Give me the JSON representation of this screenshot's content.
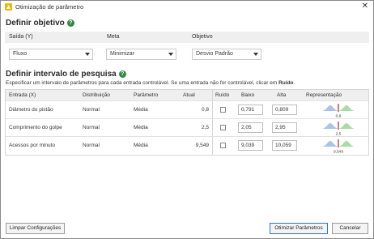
{
  "window": {
    "title": "Otimização de parâmetro",
    "close_glyph": "✕"
  },
  "objective": {
    "heading": "Definir objetivo",
    "columns": {
      "output": "Saída (Y)",
      "goal": "Meta",
      "target": "Objetivo"
    },
    "output_value": "Fluxo",
    "goal_value": "Minimizar",
    "target_value": "Desvio Padrão"
  },
  "search": {
    "heading": "Definir intervalo de pesquisa",
    "hint_prefix": "Especificar um intervalo de parâmetros para cada entrada controlável. Se uma entrada não for controlável, clicar em ",
    "hint_bold": "Ruído",
    "hint_suffix": ".",
    "columns": {
      "input": "Entrada (X)",
      "distribution": "Distribuição",
      "parameter": "Parâmetro",
      "current": "Atual",
      "noise": "Ruído",
      "low": "Baixo",
      "high": "Alta",
      "representation": "Representação"
    },
    "rows": [
      {
        "input": "Diâmetro do pistão",
        "distribution": "Normal",
        "parameter": "Média",
        "current": "0,8",
        "low": "0,791",
        "high": "0,809",
        "marker": "0,8",
        "noise": false
      },
      {
        "input": "Comprimento do golpe",
        "distribution": "Normal",
        "parameter": "Média",
        "current": "2,5",
        "low": "2,05",
        "high": "2,95",
        "marker": "2,5",
        "noise": false
      },
      {
        "input": "Acessos por minuto",
        "distribution": "Normal",
        "parameter": "Média",
        "current": "9,549",
        "low": "9,039",
        "high": "10,059",
        "marker": "9,549",
        "noise": false
      }
    ]
  },
  "buttons": {
    "reset": "Limpar Configurações",
    "optimize": "Otimizar Parâmetros",
    "cancel": "Cancelar"
  },
  "colors": {
    "low_curve": "#a9c4e6",
    "high_curve": "#a9dba5",
    "marker": "#c0392b",
    "help": "#2f8a3d",
    "primary_border": "#2b70c9"
  },
  "icons": {
    "help": "question-circle-icon",
    "dropdown": "chevron-down-icon",
    "app": "app-logo-icon"
  }
}
